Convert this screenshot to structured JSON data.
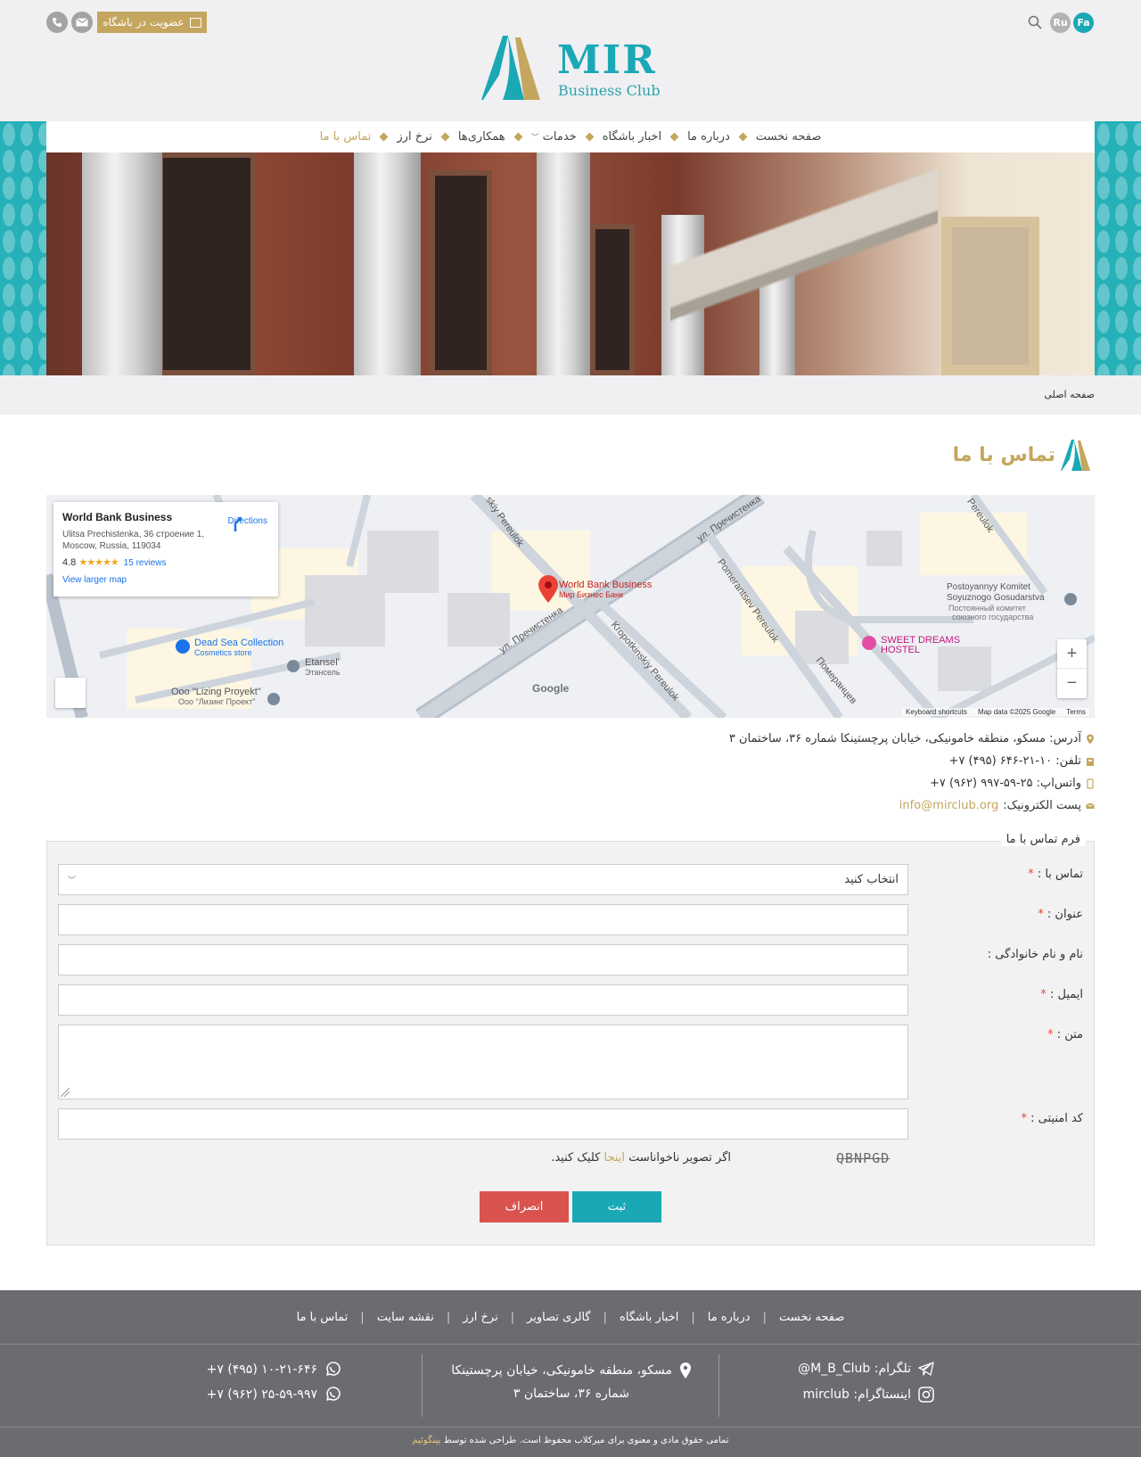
{
  "header": {
    "languages": [
      {
        "code": "Fa",
        "active": true
      },
      {
        "code": "Ru",
        "active": false
      }
    ],
    "join_label": "عضویت در باشگاه",
    "logo": {
      "name": "MIR",
      "tagline": "Business Club"
    }
  },
  "nav": {
    "items": [
      {
        "label": "صفحه نخست"
      },
      {
        "label": "درباره ما"
      },
      {
        "label": "اخبار باشگاه"
      },
      {
        "label": "خدمات"
      },
      {
        "label": "همکاری‌ها"
      },
      {
        "label": "نرخ ارز"
      },
      {
        "label": "تماس با ما"
      }
    ]
  },
  "breadcrumb": "صفحه اصلی",
  "page_title": "تماس با ما",
  "map": {
    "card": {
      "name": "World Bank Business",
      "address": "Ulitsa Prechistenka, 36 строение 1, Moscow, Russia, 119034",
      "rating": "4.8",
      "stars": "★★★★★",
      "reviews": "15 reviews",
      "directions": "Directions",
      "larger": "View larger map"
    },
    "labels": {
      "pin_name": "World Bank Business",
      "pin_sub": "Мир Бизнес Банк",
      "dead_sea": "Dead Sea Collection",
      "dead_sea_sub": "Cosmetics store",
      "etansel": "Etansel'",
      "etansel_sub": "Этансель",
      "lizing": "Ooo \"Lizing Proyekt\"",
      "lizing_sub": "Ооо \"Лизинг Проект\"",
      "hostel1": "SWEET DREAMS",
      "hostel2": "HOSTEL",
      "komitet": "Postoyannyy Komitet",
      "komitet2": "Soyuznogo Gosudarstva",
      "komitet_ru1": "Постоянный комитет",
      "komitet_ru2": "союзного государства",
      "street1": "ул. Пречистенка",
      "street2": "ул. Пречистенка",
      "street3": "Kropotkinskiy Pereulok",
      "street4": "Pomerantsev Pereulok",
      "street5": "Померанцев",
      "street6": "skiy Pereulok",
      "street7": "Pereulok",
      "google": "Google"
    },
    "footer": {
      "shortcuts": "Keyboard shortcuts",
      "data": "Map data ©2025 Google",
      "terms": "Terms"
    },
    "zoom_in": "+",
    "zoom_out": "−"
  },
  "contact": {
    "address": "آدرس: مسکو، منطقه خامونیکی، خیابان پرچستینکا شماره ۳۶، ساختمان ۳",
    "phone": "تلفن: ۱۰-۲۱-۶۴۶ (۴۹۵) ۷+",
    "whatsapp": "واتس‌اپ: ۲۵-۵۹-۹۹۷ (۹۶۲) ۷+",
    "email_label": "پست الکترونیک:",
    "email": "info@mirclub.org"
  },
  "form": {
    "legend": "فرم تماس با ما",
    "fields": {
      "contact_with": "تماس با :",
      "subject": "عنوان :",
      "fullname": "نام و نام خانوادگی :",
      "email": "ایمیل :",
      "body": "متن :",
      "captcha": "کد امنیتی :"
    },
    "select_value": "انتخاب کنید",
    "captcha_text": "QBNPGD",
    "refresh_pre": "اگر تصویر ناخواناست",
    "refresh_link": "اینجا",
    "refresh_post": "کلیک کنید.",
    "submit": "ثبت",
    "cancel": "انصراف"
  },
  "footer": {
    "links": [
      {
        "label": "صفحه نخست"
      },
      {
        "label": "درباره ما"
      },
      {
        "label": "اخبار باشگاه"
      },
      {
        "label": "گالری تصاویر"
      },
      {
        "label": "نرخ ارز"
      },
      {
        "label": "نقشه سایت"
      },
      {
        "label": "تماس با ما"
      }
    ],
    "telegram": "تلگرام: M_B_Club@",
    "instagram": "اینستاگرام: mirclub",
    "address1": "مسکو، منطقه خامونیکی، خیابان پرچستینکا",
    "address2": "شماره ۳۶، ساختمان ۳",
    "phone1": "۱۰-۲۱-۶۴۶ (۴۹۵) ۷+",
    "phone2": "۲۵-۵۹-۹۹۷ (۹۶۲) ۷+",
    "copyright": "تمامی حقوق مادی و معنوی برای میرکلاب محفوظ است. طراحی شده توسط",
    "designer": "پینگوئیم"
  },
  "colors": {
    "teal": "#1aa8b5",
    "gold": "#c4a65e",
    "red": "#d9534f",
    "footer": "#6b6c70"
  }
}
